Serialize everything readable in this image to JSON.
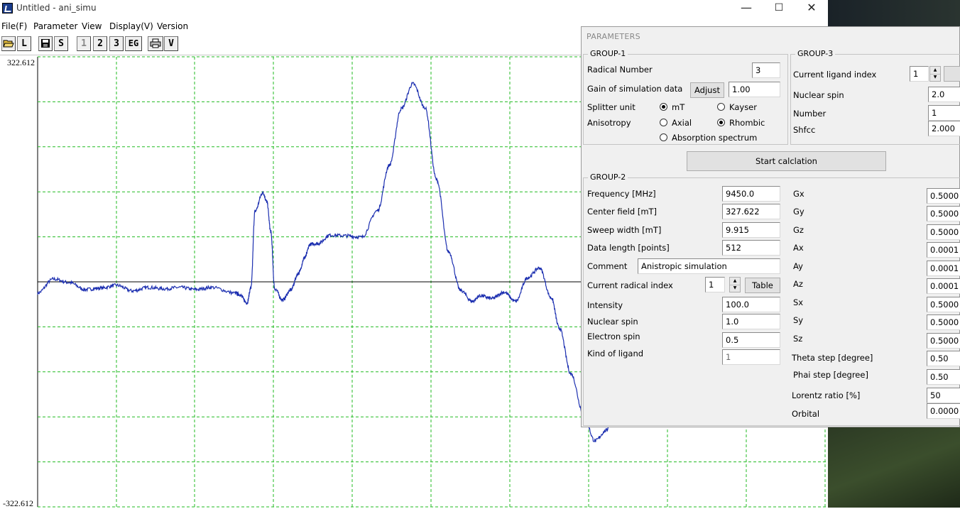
{
  "window": {
    "title": "Untitled - ani_simu",
    "minimize": "—",
    "maximize": "☐",
    "close": "✕"
  },
  "menu": [
    "File(F)",
    "Parameter",
    "View",
    "Display(V)",
    "Version"
  ],
  "toolbar": {
    "open_icon": "folder-open-icon",
    "load": "L",
    "save_icon": "floppy-disk-icon",
    "s": "S",
    "b1": "1",
    "b2": "2",
    "b3": "3",
    "eg": "EG",
    "print_icon": "printer-icon",
    "v": "V"
  },
  "plot": {
    "ymax": "322.612",
    "ymin": "-322.612"
  },
  "chart_data": {
    "type": "line",
    "ylim": [
      -322.612,
      322.612
    ],
    "grid": true,
    "grid_color": "#22bb22",
    "line_color": "#1c2fb0",
    "series": [
      {
        "x": [
          0,
          0.02,
          0.04,
          0.06,
          0.08,
          0.1,
          0.12,
          0.14,
          0.16,
          0.18,
          0.2,
          0.22,
          0.25,
          0.255,
          0.265,
          0.27,
          0.275,
          0.285,
          0.29,
          0.295,
          0.3,
          0.31,
          0.32,
          0.33,
          0.338,
          0.345,
          0.355,
          0.37,
          0.39,
          0.41,
          0.43,
          0.445,
          0.46,
          0.475,
          0.49,
          0.505,
          0.52,
          0.535,
          0.55,
          0.56,
          0.575,
          0.59,
          0.605,
          0.62,
          0.635,
          0.65,
          0.66,
          0.675,
          0.69,
          0.705,
          0.72,
          0.73,
          0.74,
          0.75,
          0.76,
          0.77
        ],
        "y": [
          -16,
          4,
          -1,
          -11,
          -9,
          -5,
          -13,
          -8,
          -10,
          -8,
          -11,
          -8,
          -16,
          -18,
          -30,
          -8,
          101,
          128,
          115,
          72,
          -10,
          -26,
          -12,
          12,
          35,
          54,
          55,
          67,
          66,
          64,
          102,
          167,
          248,
          284,
          250,
          146,
          43,
          -12,
          -28,
          -20,
          -24,
          -15,
          -28,
          6,
          20,
          -23,
          -66,
          -132,
          -186,
          -228,
          -213,
          -146,
          -92,
          -53,
          -42,
          -84
        ]
      }
    ]
  },
  "params": {
    "title": "PARAMETERS",
    "group1": {
      "title": "GROUP-1",
      "radical_number_label": "Radical Number",
      "radical_number": "3",
      "gain_label": "Gain of simulation data",
      "adjust": "Adjust",
      "gain": "1.00",
      "splitter_label": "Splitter unit",
      "mt": "mT",
      "kayser": "Kayser",
      "anisotropy_label": "Anisotropy",
      "axial": "Axial",
      "rhombic": "Rhombic",
      "absorption": "Absorption spectrum"
    },
    "group3": {
      "title": "GROUP-3",
      "ligand_index_label": "Current ligand index",
      "ligand_index": "1",
      "nuclear_spin_label": "Nuclear spin",
      "nuclear_spin": "2.0",
      "number_label": "Number",
      "number": "1",
      "shfcc_label": "Shfcc",
      "shfcc": "2.000"
    },
    "start": "Start calclation",
    "group2": {
      "title": "GROUP-2",
      "frequency_label": "Frequency [MHz]",
      "frequency": "9450.0",
      "center_label": "Center field [mT]",
      "center": "327.622",
      "sweep_label": "Sweep width [mT]",
      "sweep": "9.915",
      "length_label": "Data length [points]",
      "length": "512",
      "comment_label": "Comment",
      "comment": "Anistropic simulation",
      "radical_index_label": "Current radical index",
      "radical_index": "1",
      "table": "Table",
      "intensity_label": "Intensity",
      "intensity": "100.0",
      "nuclear_spin_label": "Nuclear spin",
      "nuclear_spin": "1.0",
      "electron_spin_label": "Electron spin",
      "electron_spin": "0.5",
      "ligand_label": "Kind of ligand",
      "ligand": "1",
      "gx_label": "Gx",
      "gx": "0.5000",
      "gy_label": "Gy",
      "gy": "0.5000",
      "gz_label": "Gz",
      "gz": "0.5000",
      "ax_label": "Ax",
      "ax": "0.0001",
      "ay_label": "Ay",
      "ay": "0.0001",
      "az_label": "Az",
      "az": "0.0001",
      "sx_label": "Sx",
      "sx": "0.5000",
      "sy_label": "Sy",
      "sy": "0.5000",
      "sz_label": "Sz",
      "sz": "0.5000",
      "theta_label": "Theta step [degree]",
      "theta": "0.50",
      "phai_label": "Phai step [degree]",
      "phai": "0.50",
      "lorentz_label": "Lorentz ratio [%]",
      "lorentz": "50",
      "orbital_label": "Orbital",
      "orbital": "0.0000"
    }
  }
}
